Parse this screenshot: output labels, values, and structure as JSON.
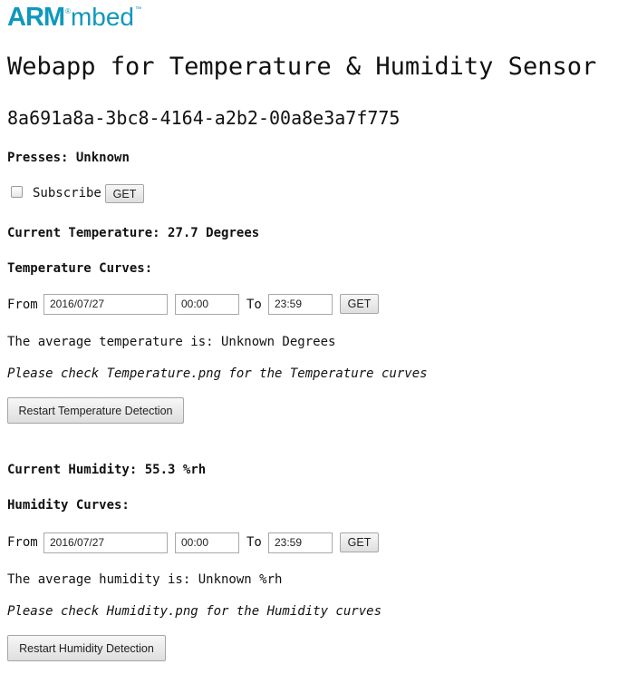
{
  "logo": {
    "arm": "ARM",
    "registered": "®",
    "mbed": "mbed",
    "trademark": "™"
  },
  "page_title": "Webapp for Temperature & Humidity Sensor",
  "device_id": "8a691a8a-3bc8-4164-a2b2-00a8e3a7f775",
  "presses": {
    "label": "Presses:",
    "value": "Unknown"
  },
  "subscribe": {
    "label": "Subscribe",
    "checked": false,
    "get_label": "GET"
  },
  "temperature": {
    "current_label": "Current Temperature:",
    "current_value": "27.7",
    "current_unit": "Degrees",
    "curves_heading": "Temperature Curves:",
    "from_label": "From",
    "from_date": "2016/07/27",
    "from_time": "00:00",
    "to_label": "To",
    "to_time": "23:59",
    "get_label": "GET",
    "average_text": "The average temperature is: Unknown Degrees",
    "note": "Please check Temperature.png for the Temperature curves",
    "restart_label": "Restart Temperature Detection"
  },
  "humidity": {
    "current_label": "Current Humidity:",
    "current_value": "55.3",
    "current_unit": "%rh",
    "curves_heading": "Humidity Curves:",
    "from_label": "From",
    "from_date": "2016/07/27",
    "from_time": "00:00",
    "to_label": "To",
    "to_time": "23:59",
    "get_label": "GET",
    "average_text": "The average humidity is: Unknown %rh",
    "note": "Please check Humidity.png for the Humidity curves",
    "restart_label": "Restart Humidity Detection"
  },
  "colors": {
    "brand": "#0f98bd"
  }
}
